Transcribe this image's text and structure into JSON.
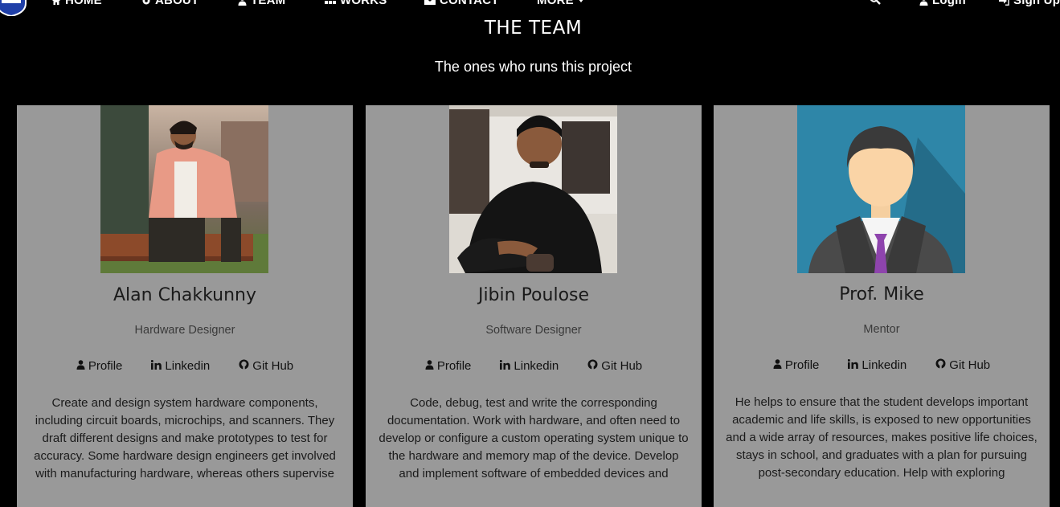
{
  "nav": {
    "items": [
      {
        "label": "HOME",
        "icon": "home-icon"
      },
      {
        "label": "ABOUT",
        "icon": "gear-icon"
      },
      {
        "label": "TEAM",
        "icon": "user-icon"
      },
      {
        "label": "WORKS",
        "icon": "grid-icon"
      },
      {
        "label": "CONTACT",
        "icon": "mail-icon"
      },
      {
        "label": "MORE",
        "icon": "caret-down-icon"
      }
    ],
    "right": [
      {
        "label": "",
        "icon": "search-icon"
      },
      {
        "label": "Login",
        "icon": "user-icon"
      },
      {
        "label": "Sign Up",
        "icon": "sign-in-icon"
      }
    ]
  },
  "header": {
    "title": "THE TEAM",
    "subtitle": "The ones who runs this project"
  },
  "cards": [
    {
      "name": "Alan Chakkunny",
      "role": "Hardware Designer",
      "links": {
        "profile": "Profile",
        "linkedin": "Linkedin",
        "github": "Git Hub"
      },
      "description": "Create and design system hardware components, including circuit boards, microchips, and scanners. They draft different designs and make prototypes to test for accuracy. Some hardware design engineers get involved with manufacturing hardware, whereas others supervise"
    },
    {
      "name": "Jibin Poulose",
      "role": "Software Designer",
      "links": {
        "profile": "Profile",
        "linkedin": "Linkedin",
        "github": "Git Hub"
      },
      "description": "Code, debug, test and write the corresponding documentation. Work with hardware, and often need to develop or configure a custom operating system unique to the hardware and memory map of the device. Develop and implement software of embedded devices and"
    },
    {
      "name": "Prof. Mike",
      "role": "Mentor",
      "links": {
        "profile": "Profile",
        "linkedin": "Linkedin",
        "github": "Git Hub"
      },
      "description": "He helps to ensure that the student develops important academic and life skills, is exposed to new opportunities and a wide array of resources, makes positive life choices, stays in school, and graduates with a plan for pursuing post-secondary education. Help with exploring"
    }
  ],
  "colors": {
    "background": "#000000",
    "card": "#999999",
    "avatar_bg": "#2e86a8",
    "tie": "#8e44ad"
  }
}
